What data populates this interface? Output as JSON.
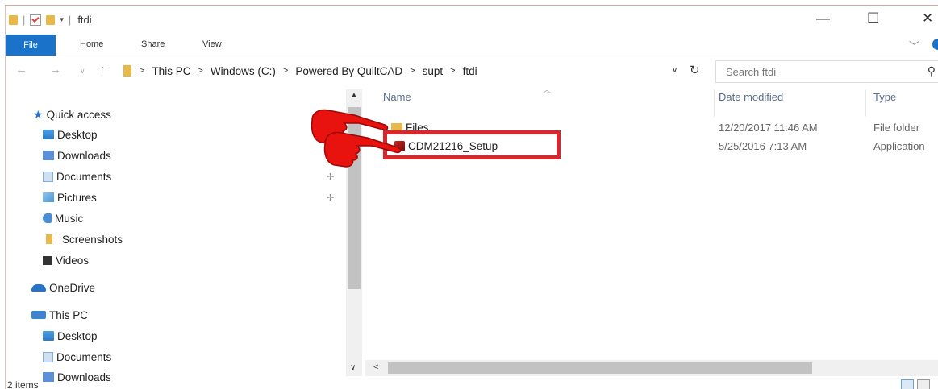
{
  "window": {
    "title": "ftdi",
    "minimize": "—",
    "maximize": "☐",
    "close": "✕"
  },
  "ribbon": {
    "file": "File",
    "tabs": [
      "Home",
      "Share",
      "View"
    ]
  },
  "address": {
    "breadcrumbs": [
      "This PC",
      "Windows (C:)",
      "Powered By QuiltCAD",
      "supt",
      "ftdi"
    ],
    "search_placeholder": "Search ftdi"
  },
  "nav": {
    "quick_access": "Quick access",
    "quick_items": [
      "Desktop",
      "Downloads",
      "Documents",
      "Pictures",
      "Music",
      "Screenshots",
      "Videos"
    ],
    "onedrive": "OneDrive",
    "this_pc": "This PC",
    "pc_items": [
      "Desktop",
      "Documents",
      "Downloads"
    ]
  },
  "columns": {
    "name": "Name",
    "date": "Date modified",
    "type": "Type"
  },
  "files": [
    {
      "name": "Files",
      "date": "12/20/2017 11:46 AM",
      "type": "File folder",
      "icon": "folder-icon"
    },
    {
      "name": "CDM21216_Setup",
      "date": "5/25/2016 7:13 AM",
      "type": "Application",
      "icon": "application-icon"
    }
  ],
  "status": {
    "count": "2 items"
  },
  "colors": {
    "accent": "#1a73c8",
    "highlight": "#d8262e"
  }
}
